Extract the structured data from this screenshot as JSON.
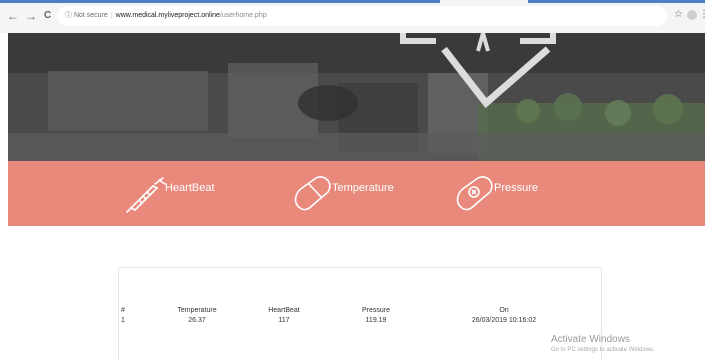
{
  "browser": {
    "security_text": "Not secure",
    "url_host": "www.medical.myliveproject.online",
    "url_path": "/userhome.php",
    "back_glyph": "←",
    "forward_glyph": "→",
    "reload_glyph": "C",
    "info_glyph": "ⓘ",
    "star_glyph": "☆",
    "menu_glyph": "⋮"
  },
  "features": [
    {
      "label": "HeartBeat",
      "icon": "syringe-icon"
    },
    {
      "label": "Temperature",
      "icon": "capsule-icon"
    },
    {
      "label": "Pressure",
      "icon": "pill-icon"
    }
  ],
  "table": {
    "headers": [
      "#",
      "Temperature",
      "HeartBeat",
      "Pressure",
      "On"
    ],
    "rows": [
      [
        "1",
        "26.37",
        "117",
        "119.19",
        "26/03/2019 10:16:02"
      ]
    ]
  },
  "watermark": {
    "line1": "Activate Windows",
    "line2": "Go to PC settings to activate Windows."
  },
  "colors": {
    "band": "#e8897c",
    "tab_accent": "#4f7fc2"
  }
}
